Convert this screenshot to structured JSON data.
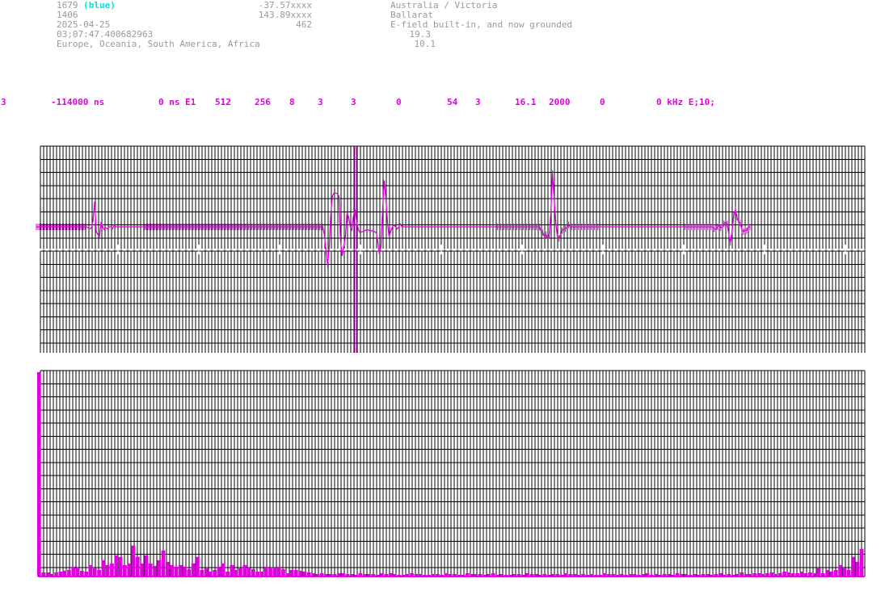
{
  "header": {
    "station_id": "1679",
    "station_color": "(blue)",
    "number": "1406",
    "date": "2025-04-25",
    "time": "03;07:47.400682963",
    "regions": "Europe, Oceania, South America, Africa",
    "lat": "-37.57xxxx",
    "lon": "143.89xxxx",
    "alt": "462",
    "country_region": "Australia / Victoria",
    "city": "Ballarat",
    "antenna": "E-field built-in, and now grounded",
    "val1": "19.3",
    "val2": "10.1"
  },
  "params": [
    "3",
    "-114000 ns",
    "0 ns E1",
    "512",
    "256",
    "8",
    "3",
    "3",
    "0",
    "54",
    "3",
    "16.1",
    "2000",
    "0",
    "0 kHz E;10;"
  ],
  "colors": {
    "grid": "#000000",
    "trace": "#e000e0",
    "label": "#9a9a9a",
    "accent": "#00e0e0"
  },
  "chart_data": [
    {
      "type": "line",
      "title": "",
      "grid": true,
      "cursor_sample": 197,
      "samples": 512,
      "series": [
        {
          "values": [
            0,
            0,
            0,
            0,
            0,
            0,
            0,
            0,
            0,
            0,
            0,
            0,
            0,
            0,
            0,
            0,
            0,
            0,
            0,
            0,
            0,
            0,
            0,
            0,
            0,
            0,
            0,
            0,
            0,
            0,
            0,
            0,
            -1,
            -2,
            -1,
            6,
            26,
            -5,
            -8,
            -10,
            5,
            0,
            -3,
            -1,
            -2,
            0,
            0,
            -2,
            2,
            0,
            0,
            0,
            0,
            0,
            0,
            0,
            0,
            0,
            0,
            0,
            0,
            0,
            0,
            0,
            0,
            0,
            0,
            0,
            0,
            0,
            0,
            0,
            0,
            0,
            0,
            0,
            0,
            0,
            0,
            0,
            0,
            0,
            0,
            0,
            0,
            0,
            0,
            0,
            0,
            0,
            0,
            0,
            0,
            0,
            0,
            0,
            0,
            0,
            0,
            0,
            0,
            0,
            0,
            0,
            0,
            0,
            0,
            0,
            0,
            0,
            0,
            0,
            0,
            0,
            0,
            0,
            0,
            0,
            0,
            0,
            0,
            0,
            0,
            0,
            0,
            0,
            0,
            0,
            0,
            0,
            0,
            0,
            0,
            0,
            0,
            0,
            0,
            0,
            0,
            0,
            0,
            0,
            0,
            0,
            0,
            0,
            0,
            0,
            0,
            0,
            0,
            0,
            0,
            0,
            0,
            0,
            0,
            0,
            0,
            0,
            0,
            0,
            0,
            0,
            0,
            0,
            0,
            0,
            0,
            0,
            0,
            0,
            0,
            0,
            0,
            0,
            0,
            0,
            -8,
            -25,
            -40,
            -20,
            15,
            32,
            35,
            35,
            34,
            32,
            -15,
            -30,
            -20,
            -10,
            15,
            10,
            0,
            -3,
            12,
            18,
            5,
            -3,
            -6,
            -5,
            -5,
            -4,
            -3,
            -3,
            -4,
            -4,
            -4,
            -5,
            -6,
            -15,
            -28,
            -20,
            18,
            48,
            30,
            5,
            -10,
            -5,
            0,
            2,
            0,
            -2,
            0,
            3,
            0,
            0,
            0,
            0,
            0,
            0,
            0,
            0,
            0,
            0,
            0,
            0,
            0,
            0,
            0,
            0,
            0,
            0,
            0,
            0,
            0,
            0,
            0,
            0,
            0,
            0,
            0,
            0,
            0,
            0,
            0,
            0,
            0,
            0,
            0,
            0,
            0,
            0,
            0,
            0,
            0,
            0,
            0,
            0,
            0,
            0,
            0,
            0,
            0,
            0,
            0,
            0,
            0,
            0,
            0,
            0,
            0,
            0,
            0,
            0,
            0,
            0,
            0,
            0,
            0,
            0,
            0,
            0,
            0,
            0,
            0,
            0,
            0,
            0,
            0,
            0,
            0,
            0,
            0,
            0,
            0,
            0,
            0,
            0,
            0,
            0,
            -5,
            -6,
            -10,
            -8,
            -12,
            -8,
            15,
            55,
            30,
            5,
            -10,
            -12,
            -8,
            -4,
            -2,
            -2,
            0,
            2,
            0,
            0,
            0,
            0,
            0,
            0,
            0,
            0,
            0,
            0,
            0,
            0,
            0,
            0,
            0,
            0,
            0,
            0,
            0,
            0,
            0,
            0,
            0,
            0,
            0,
            0,
            0,
            0,
            0,
            0,
            0,
            0,
            0,
            0,
            0,
            0,
            0,
            0,
            0,
            0,
            0,
            0,
            0,
            0,
            0,
            0,
            0,
            0,
            0,
            0,
            0,
            0,
            0,
            0,
            0,
            0,
            0,
            0,
            0,
            0,
            0,
            0,
            0,
            0,
            0,
            0,
            0,
            0,
            0,
            0,
            0,
            0,
            0,
            0,
            0,
            0,
            0,
            0,
            0,
            0,
            0,
            0,
            0,
            0,
            0,
            0,
            0,
            0,
            0,
            -2,
            -3,
            0,
            2,
            -1,
            0,
            3,
            5,
            3,
            -8,
            -16,
            -5,
            12,
            18,
            10,
            5,
            4,
            -3,
            -5,
            -3,
            -4,
            0,
            0
          ]
        }
      ]
    },
    {
      "type": "bar",
      "title": "",
      "grid": true,
      "ylim": [
        0,
        256
      ],
      "values": [
        252,
        5,
        5,
        3,
        5,
        6,
        7,
        8,
        12,
        10,
        7,
        6,
        14,
        10,
        8,
        20,
        14,
        16,
        26,
        24,
        14,
        16,
        38,
        24,
        16,
        26,
        16,
        13,
        20,
        32,
        18,
        14,
        12,
        14,
        12,
        9,
        16,
        24,
        8,
        10,
        6,
        8,
        12,
        16,
        6,
        14,
        8,
        10,
        14,
        10,
        9,
        6,
        6,
        12,
        10,
        11,
        12,
        9,
        4,
        8,
        8,
        7,
        6,
        5,
        4,
        3,
        4,
        3,
        3,
        3,
        4,
        4,
        3,
        3,
        2,
        4,
        3,
        3,
        3,
        2,
        4,
        3,
        4,
        3,
        2,
        2,
        3,
        4,
        3,
        3,
        2,
        2,
        3,
        3,
        2,
        4,
        3,
        3,
        2,
        2,
        4,
        3,
        3,
        3,
        2,
        3,
        4,
        2,
        3,
        2,
        2,
        3,
        3,
        2,
        4,
        3,
        3,
        2,
        3,
        2,
        3,
        3,
        2,
        4,
        3,
        3,
        2,
        3,
        2,
        3,
        2,
        2,
        4,
        3,
        3,
        2,
        3,
        2,
        3,
        3,
        2,
        3,
        4,
        2,
        3,
        2,
        3,
        3,
        2,
        4,
        3,
        3,
        2,
        3,
        2,
        3,
        3,
        2,
        3,
        4,
        2,
        3,
        2,
        3,
        5,
        3,
        3,
        4,
        4,
        3,
        4,
        5,
        3,
        4,
        6,
        5,
        4,
        4,
        6,
        4,
        5,
        4,
        10,
        4,
        8,
        6,
        8,
        14,
        10,
        8,
        24,
        18,
        34
      ]
    }
  ]
}
